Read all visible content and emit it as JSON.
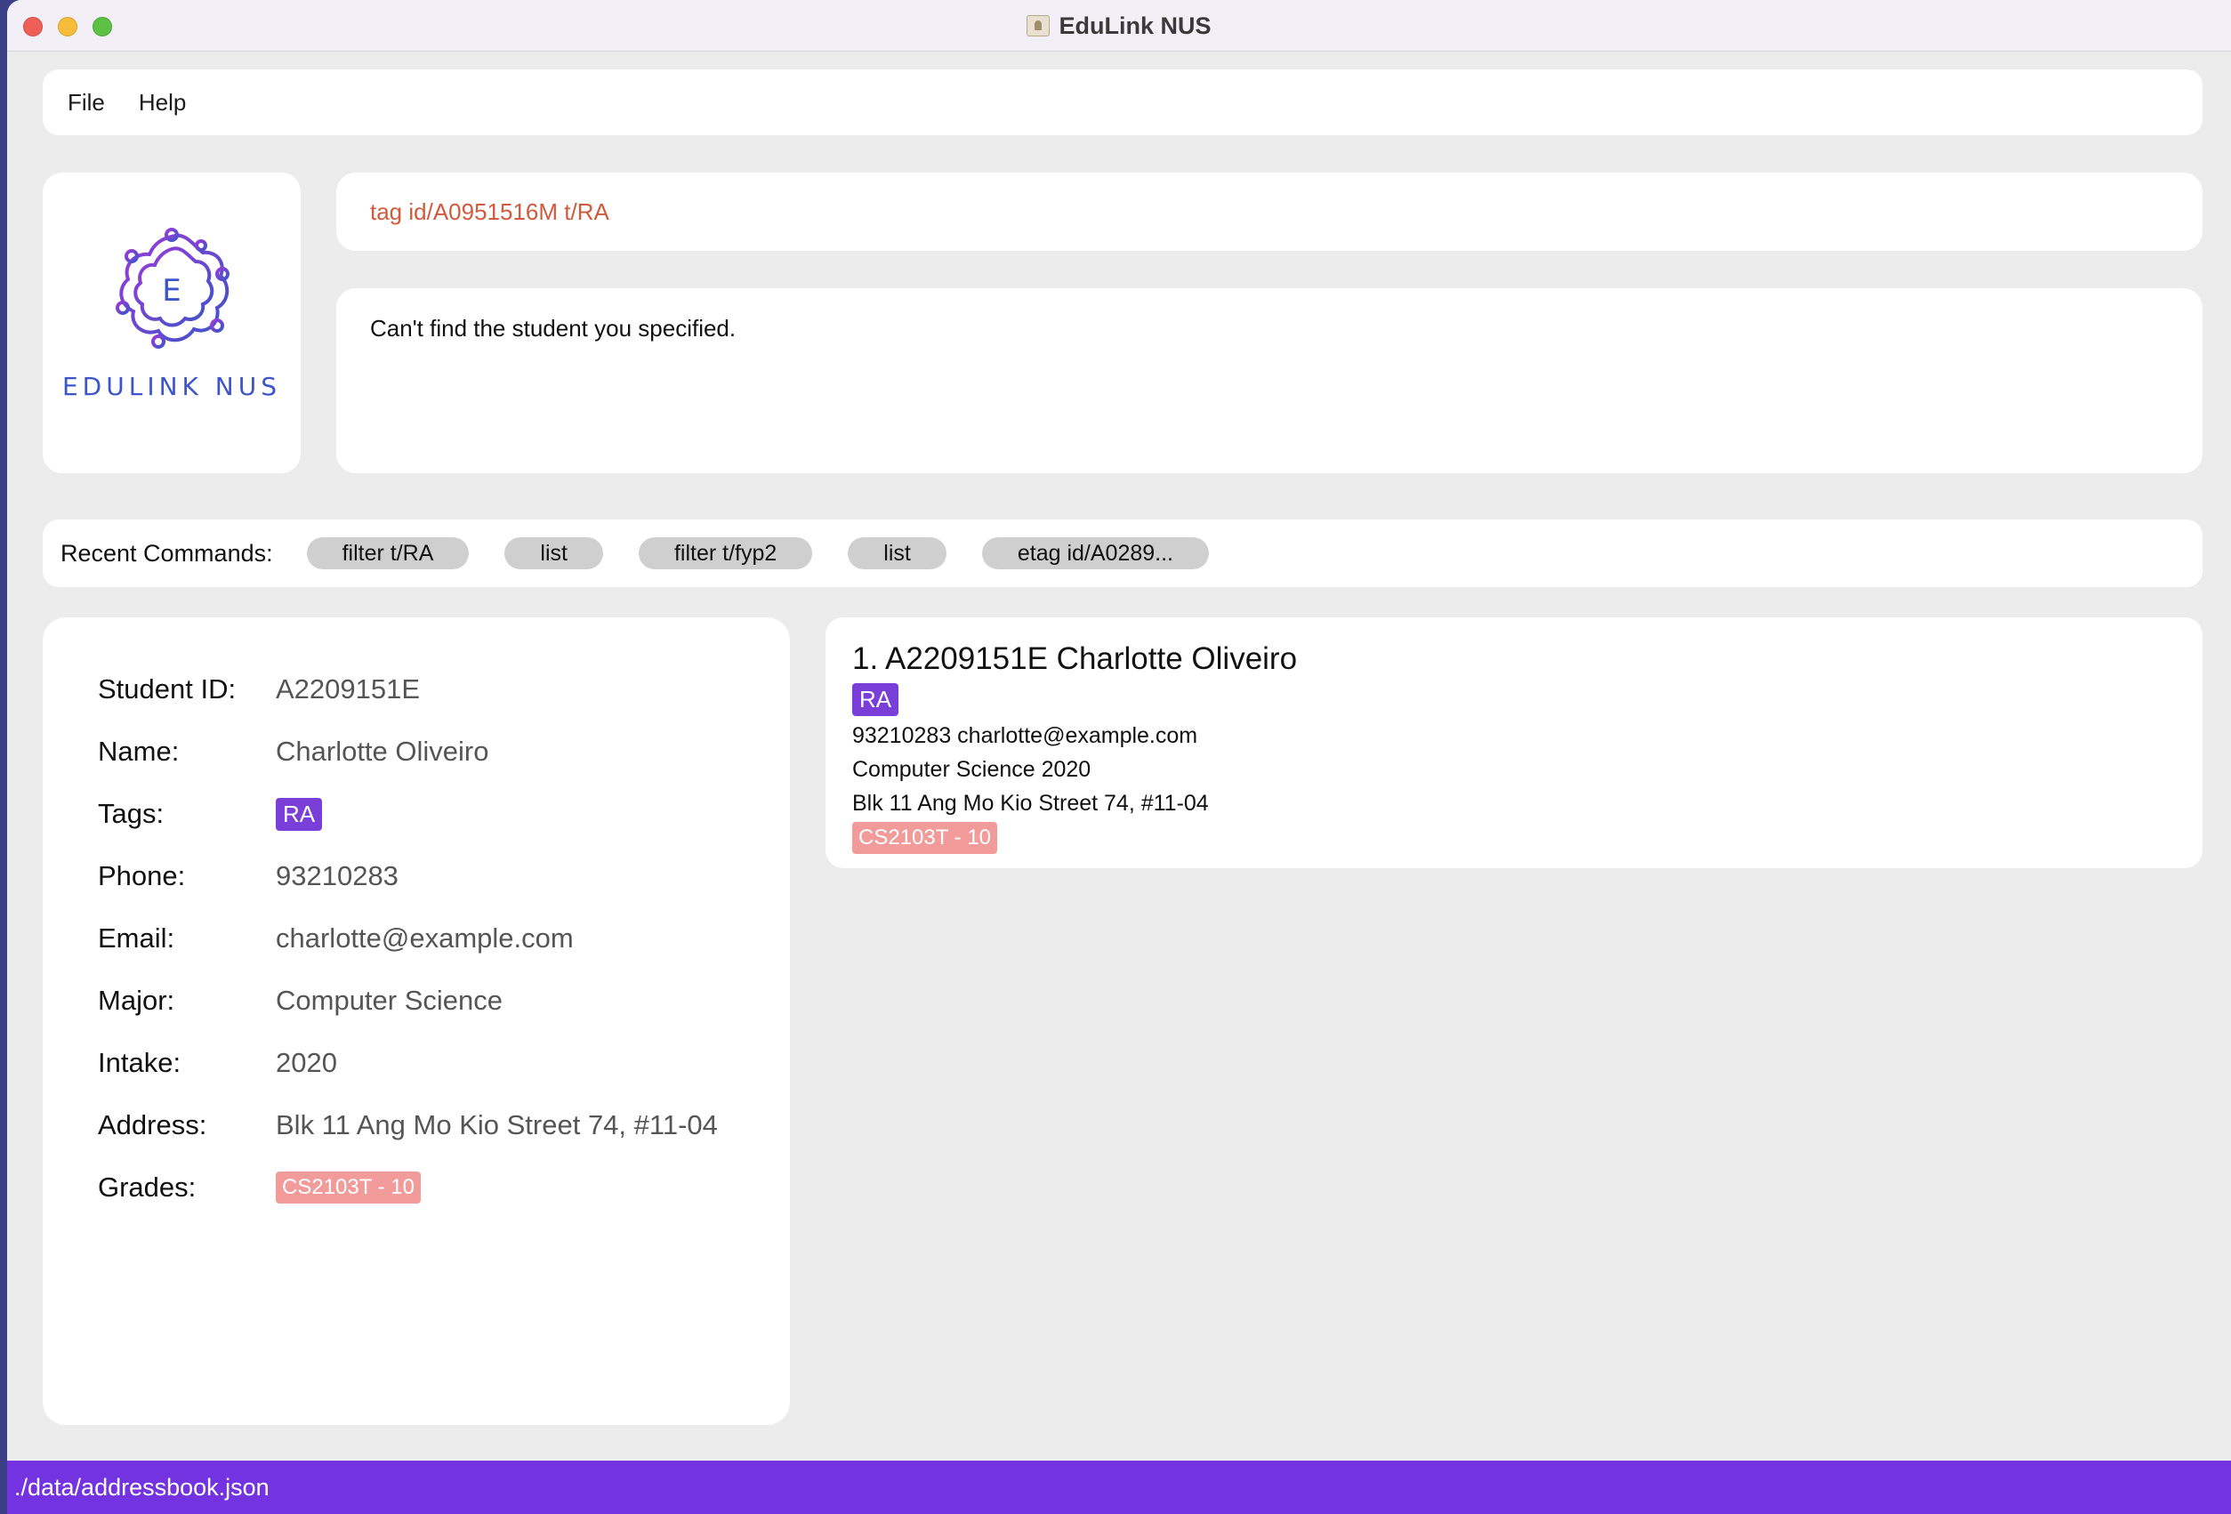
{
  "window": {
    "title": "EduLink NUS"
  },
  "menu": {
    "items": [
      "File",
      "Help"
    ]
  },
  "logo": {
    "letter": "E",
    "brand_text": "EDULINK NUS"
  },
  "command": {
    "value": "tag id/A0951516M t/RA"
  },
  "result": {
    "message": "Can't find the student you specified."
  },
  "recent": {
    "label": "Recent Commands:",
    "chips": [
      "filter t/RA",
      "list",
      "filter t/fyp2",
      "list",
      "etag id/A0289..."
    ]
  },
  "detail": {
    "rows": [
      {
        "label": "Student ID:",
        "value": "A2209151E"
      },
      {
        "label": "Name:",
        "value": "Charlotte Oliveiro"
      },
      {
        "label": "Tags:",
        "value": "RA"
      },
      {
        "label": "Phone:",
        "value": "93210283"
      },
      {
        "label": "Email:",
        "value": "charlotte@example.com"
      },
      {
        "label": "Major:",
        "value": "Computer Science"
      },
      {
        "label": "Intake:",
        "value": "2020"
      },
      {
        "label": "Address:",
        "value": "Blk 11 Ang Mo Kio Street 74, #11-04"
      },
      {
        "label": "Grades:",
        "value": "CS2103T - 10"
      }
    ]
  },
  "list": {
    "items": [
      {
        "index": "1.",
        "title": "A2209151E Charlotte Oliveiro",
        "tag": "RA",
        "contact": "93210283  charlotte@example.com",
        "major_intake": "Computer Science  2020",
        "address": "Blk 11 Ang Mo Kio Street 74, #11-04",
        "grade": "CS2103T - 10"
      }
    ]
  },
  "status": {
    "path": "./data/addressbook.json"
  },
  "colors": {
    "accent": "#7433e0",
    "tag": "#7a3fd9",
    "grade": "#f19b9b",
    "command_text": "#d05a3c",
    "brand": "#3d55c9"
  }
}
